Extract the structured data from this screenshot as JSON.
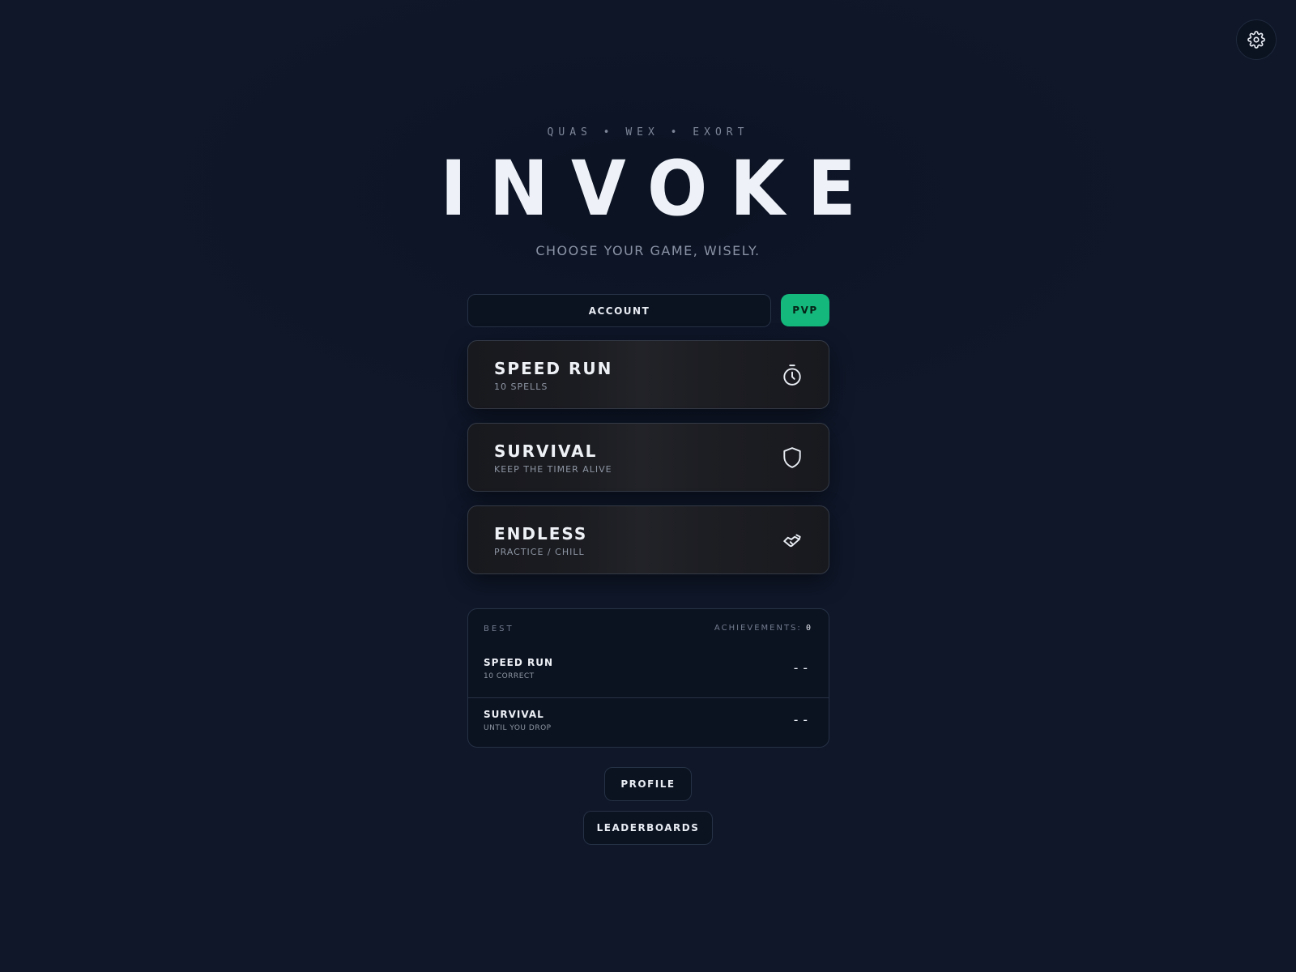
{
  "header": {
    "tagline": "QUAS • WEX • EXORT",
    "logo": "INVOKE",
    "subtitle": "CHOOSE YOUR GAME, WISELY."
  },
  "settings": {
    "icon": "gear-icon"
  },
  "top_buttons": {
    "account_label": "ACCOUNT",
    "pvp_label": "PVP",
    "pvp_color": "#14b87c"
  },
  "modes": [
    {
      "title": "SPEED RUN",
      "subtitle": "10 SPELLS",
      "icon": "stopwatch-icon"
    },
    {
      "title": "SURVIVAL",
      "subtitle": "KEEP THE TIMER ALIVE",
      "icon": "shield-icon"
    },
    {
      "title": "ENDLESS",
      "subtitle": "PRACTICE / CHILL",
      "icon": "handshake-icon"
    }
  ],
  "best": {
    "label": "BEST",
    "achievements_label": "ACHIEVEMENTS:",
    "achievements_count": "0",
    "rows": [
      {
        "title": "SPEED RUN",
        "subtitle": "10 CORRECT",
        "value": "--"
      },
      {
        "title": "SURVIVAL",
        "subtitle": "UNTIL YOU DROP",
        "value": "--"
      }
    ]
  },
  "bottom_buttons": {
    "profile_label": "PROFILE",
    "leaderboards_label": "LEADERBOARDS"
  }
}
